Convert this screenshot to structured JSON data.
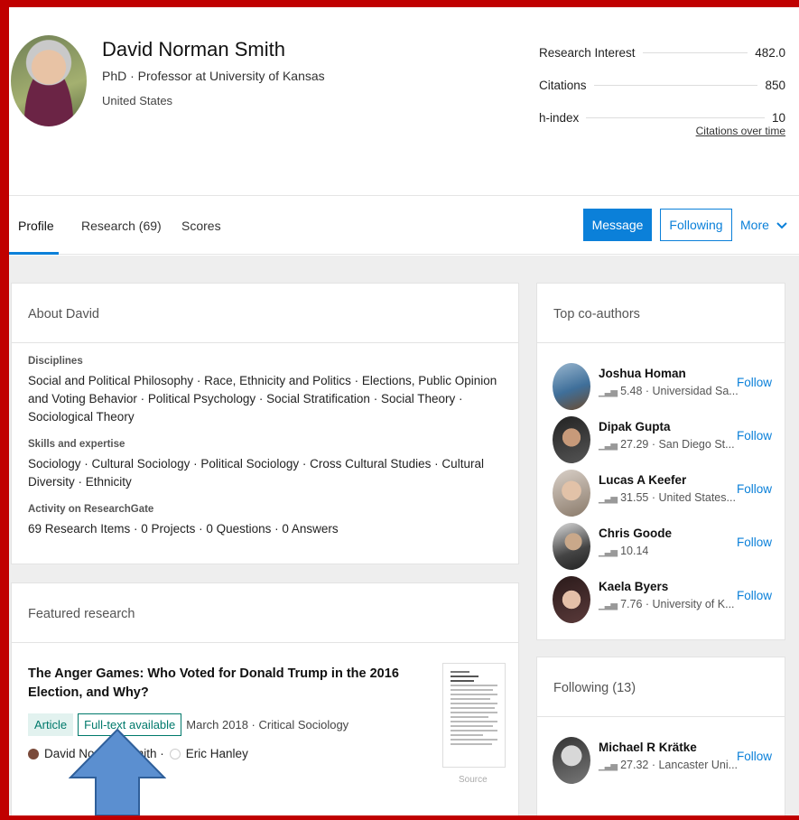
{
  "profile": {
    "name": "David Norman Smith",
    "subtitle": "PhD · Professor at University of Kansas",
    "country": "United States"
  },
  "stats": [
    {
      "label": "Research Interest",
      "value": "482.0"
    },
    {
      "label": "Citations",
      "value": "850"
    },
    {
      "label": "h-index",
      "value": "10"
    }
  ],
  "citations_link": "Citations over time",
  "tabs": [
    {
      "label": "Profile"
    },
    {
      "label": "Research (69)"
    },
    {
      "label": "Scores"
    }
  ],
  "actions": {
    "message": "Message",
    "following": "Following",
    "more": "More"
  },
  "about": {
    "title": "About David",
    "disciplines_label": "Disciplines",
    "disciplines_text": "Social and Political Philosophy · Race, Ethnicity and Politics · Elections, Public Opinion and Voting Behavior · Political Psychology · Social Stratification · Social Theory · Sociological Theory",
    "skills_label": "Skills and expertise",
    "skills_text": "Sociology · Cultural Sociology · Political Sociology · Cross Cultural Studies · Cultural Diversity · Ethnicity",
    "activity_label": "Activity on ResearchGate",
    "activity_text": "69 Research Items · 0 Projects · 0 Questions · 0 Answers"
  },
  "featured": {
    "title": "Featured research",
    "paper_title": "The Anger Games: Who Voted for Donald Trump in the 2016 Election, and Why?",
    "type": "Article",
    "fulltext": "Full-text available",
    "meta": "March 2018 · Critical Sociology",
    "author1": "David Norman Smith ·",
    "author2": "Eric Hanley",
    "thumb_caption": "Source"
  },
  "coauthors": {
    "title": "Top co-authors",
    "follow_label": "Follow",
    "people": [
      {
        "name": "Joshua Homan",
        "meta": "5.48 · Universidad Sa...",
        "color": "#3f6f9a"
      },
      {
        "name": "Dipak Gupta",
        "meta": "27.29 · San Diego St...",
        "color": "#2b2b2b"
      },
      {
        "name": "Lucas A Keefer",
        "meta": "31.55 · United States...",
        "color": "#9a8a7a"
      },
      {
        "name": "Chris Goode",
        "meta": "10.14",
        "color": "#5b5b5b"
      },
      {
        "name": "Kaela Byers",
        "meta": "7.76 · University of K...",
        "color": "#4a2a2a"
      }
    ]
  },
  "following": {
    "title": "Following (13)",
    "people": [
      {
        "name": "Michael R Krätke",
        "meta": "27.32 · Lancaster Uni...",
        "color": "#777777"
      }
    ]
  },
  "colors": {
    "accent": "#0b80d9",
    "frame": "#c00000",
    "arrow": "#5b8fd0",
    "teal": "#00796b"
  }
}
